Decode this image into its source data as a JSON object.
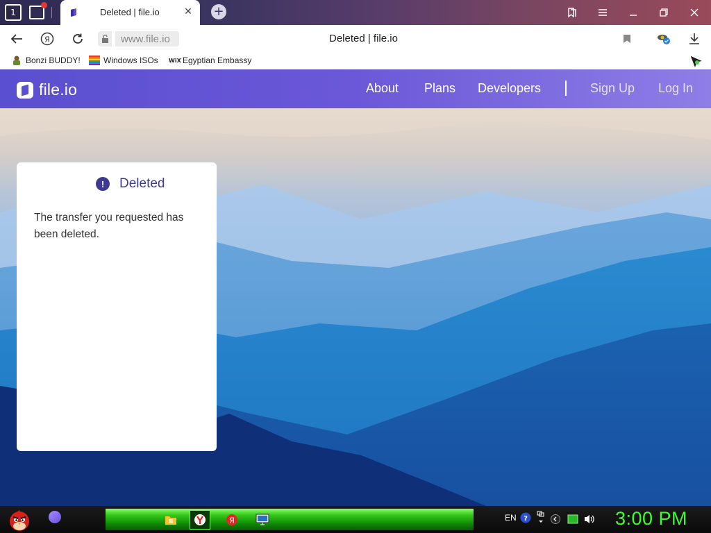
{
  "browser": {
    "tab_counter": "1",
    "active_tab_title": "Deleted | file.io",
    "url": "www.file.io",
    "page_title": "Deleted | file.io"
  },
  "bookmarks": [
    {
      "label": "Bonzi BUDDY!",
      "icon": "bonzi-icon"
    },
    {
      "label": "Windows ISOs",
      "icon": "rainbow-flag-icon"
    },
    {
      "label": "Egyptian Embassy",
      "icon": "wix-icon",
      "icon_text": "WiX"
    }
  ],
  "site": {
    "logo_text": "file.io",
    "nav": {
      "about": "About",
      "plans": "Plans",
      "developers": "Developers",
      "signup": "Sign Up",
      "login": "Log In"
    }
  },
  "card": {
    "title": "Deleted",
    "icon": "!",
    "message": "The transfer you requested has been deleted."
  },
  "taskbar": {
    "language": "EN",
    "clock": "3:00 PM"
  },
  "colors": {
    "brand": "#5a4fd0",
    "card_title": "#3f3a8f",
    "clock": "#3cff2a"
  }
}
